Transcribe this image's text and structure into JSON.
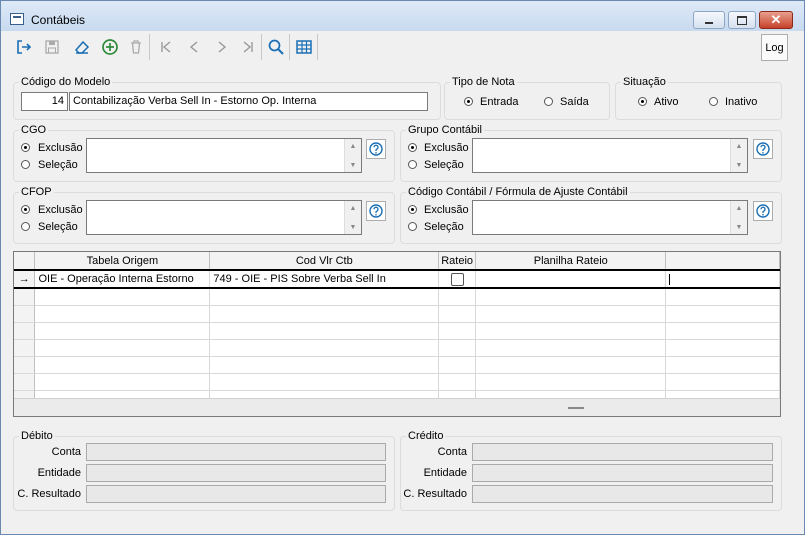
{
  "window": {
    "title": "Contábeis"
  },
  "toolbar": {
    "buttons": [
      {
        "icon": "exit-icon"
      },
      {
        "icon": "save-icon"
      },
      {
        "icon": "eraser-icon"
      },
      {
        "icon": "add-icon"
      },
      {
        "icon": "delete-icon"
      },
      {
        "icon": "first-record-icon"
      },
      {
        "icon": "previous-record-icon"
      },
      {
        "icon": "next-record-icon"
      },
      {
        "icon": "last-record-icon"
      },
      {
        "icon": "search-icon"
      },
      {
        "icon": "table-icon"
      }
    ],
    "log_label": "Log"
  },
  "modelo": {
    "label": "Código do Modelo",
    "code": "14",
    "description": "Contabilização Verba Sell In - Estorno Op. Interna"
  },
  "tipo_nota": {
    "label": "Tipo de Nota",
    "options": [
      "Entrada",
      "Saída"
    ],
    "selected": "Entrada"
  },
  "situacao": {
    "label": "Situação",
    "options": [
      "Ativo",
      "Inativo"
    ],
    "selected": "Ativo"
  },
  "cgo": {
    "label": "CGO",
    "options": [
      "Exclusão",
      "Seleção"
    ],
    "selected": "Exclusão"
  },
  "grupo_contabil": {
    "label": "Grupo Contábil",
    "options": [
      "Exclusão",
      "Seleção"
    ],
    "selected": "Exclusão"
  },
  "cfop": {
    "label": "CFOP",
    "options": [
      "Exclusão",
      "Seleção"
    ],
    "selected": "Exclusão"
  },
  "codigo_contabil": {
    "label": "Código Contábil / Fórmula de Ajuste Contábil",
    "options": [
      "Exclusão",
      "Seleção"
    ],
    "selected": "Exclusão"
  },
  "grid": {
    "columns": [
      "Tabela Origem",
      "Cod Vlr Ctb",
      "Rateio",
      "Planilha Rateio",
      ""
    ],
    "rows": [
      {
        "indicator": "→",
        "tabela_origem": "OIE - Operação Interna Estorno",
        "cod_vlr_ctb": "749 - OIE - PIS Sobre Verba Sell In",
        "rateio": false,
        "planilha_rateio": ""
      }
    ],
    "empty_rows": 7
  },
  "debito": {
    "label": "Débito",
    "fields": [
      "Conta",
      "Entidade",
      "C. Resultado"
    ]
  },
  "credito": {
    "label": "Crédito",
    "fields": [
      "Conta",
      "Entidade",
      "C. Resultado"
    ]
  },
  "colors": {
    "accent": "#1a6fb5",
    "add": "#2e8b3a",
    "titlebar": "#c8daf0"
  }
}
